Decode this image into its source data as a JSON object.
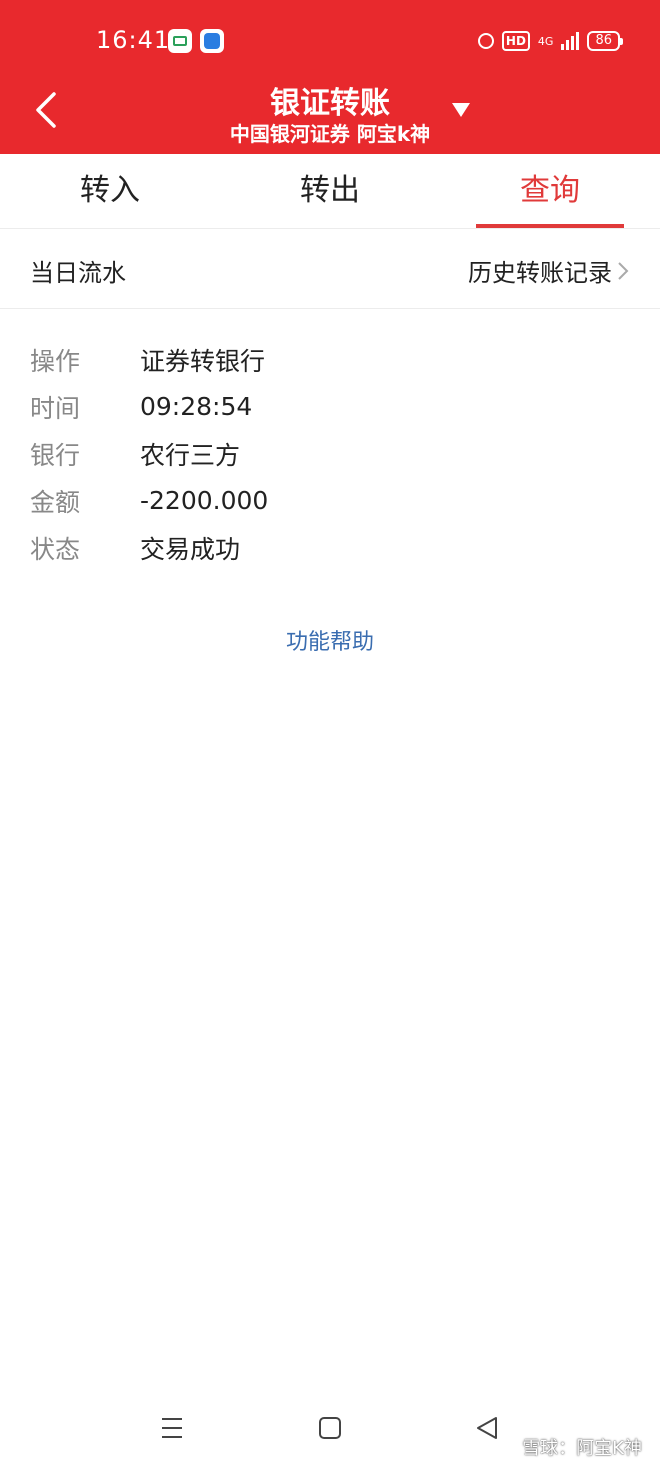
{
  "status_bar": {
    "time": "16:41",
    "hd": "HD",
    "network": "4G",
    "battery": "86"
  },
  "header": {
    "title": "银证转账",
    "subtitle": "中国银河证券 阿宝k神"
  },
  "tabs": [
    {
      "label": "转入",
      "active": false
    },
    {
      "label": "转出",
      "active": false
    },
    {
      "label": "查询",
      "active": true
    }
  ],
  "section": {
    "title": "当日流水",
    "history_link": "历史转账记录"
  },
  "record": [
    {
      "label": "操作",
      "value": "证券转银行"
    },
    {
      "label": "时间",
      "value": "09:28:54"
    },
    {
      "label": "银行",
      "value": "农行三方"
    },
    {
      "label": "金额",
      "value": "-2200.000"
    },
    {
      "label": "状态",
      "value": "交易成功"
    }
  ],
  "help_link": "功能帮助",
  "watermark": "雪球：阿宝K神",
  "colors": {
    "brand_red": "#e8292d",
    "active_tab": "#e03a3a",
    "link_blue": "#3a6db0",
    "label_gray": "#888888"
  },
  "icons": [
    "back-arrow-icon",
    "dropdown-triangle-icon",
    "chevron-right-icon",
    "menu-icon",
    "home-icon",
    "back-triangle-icon",
    "alarm-icon",
    "signal-icon",
    "battery-icon"
  ]
}
